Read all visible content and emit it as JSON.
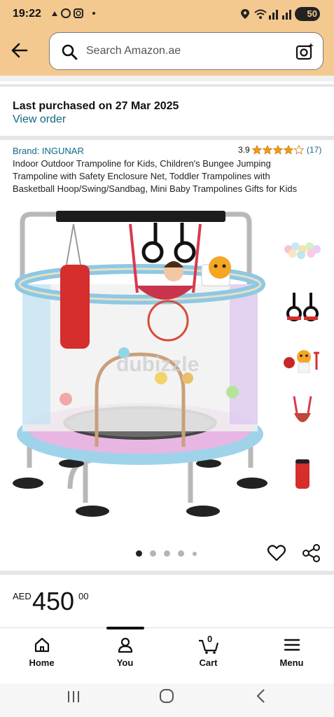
{
  "status_bar": {
    "time": "19:22",
    "battery": "50"
  },
  "search": {
    "placeholder": "Search Amazon.ae"
  },
  "purchase": {
    "text": "Last purchased on 27 Mar 2025",
    "link": "View order"
  },
  "product": {
    "brand": "Brand: INGUNAR",
    "rating": "3.9",
    "rating_value": 3.9,
    "review_count": "(17)",
    "title": "Indoor Outdoor Trampoline for Kids, Children's Bungee Jumping Trampoline with Safety Enclosure Net, Toddler Trampolines with Basketball Hoop/Swing/Sandbag, Mini Baby Trampolines Gifts for Kids",
    "watermark": "dubizzle"
  },
  "gallery": {
    "active_index": 0,
    "dot_count": 5
  },
  "price": {
    "currency": "AED",
    "whole": "450",
    "fraction": "00"
  },
  "nav": {
    "home": "Home",
    "you": "You",
    "cart": "Cart",
    "cart_count": "0",
    "menu": "Menu"
  },
  "colors": {
    "header": "#f3c98f",
    "link": "#0f6a87",
    "star": "#f39c12"
  }
}
